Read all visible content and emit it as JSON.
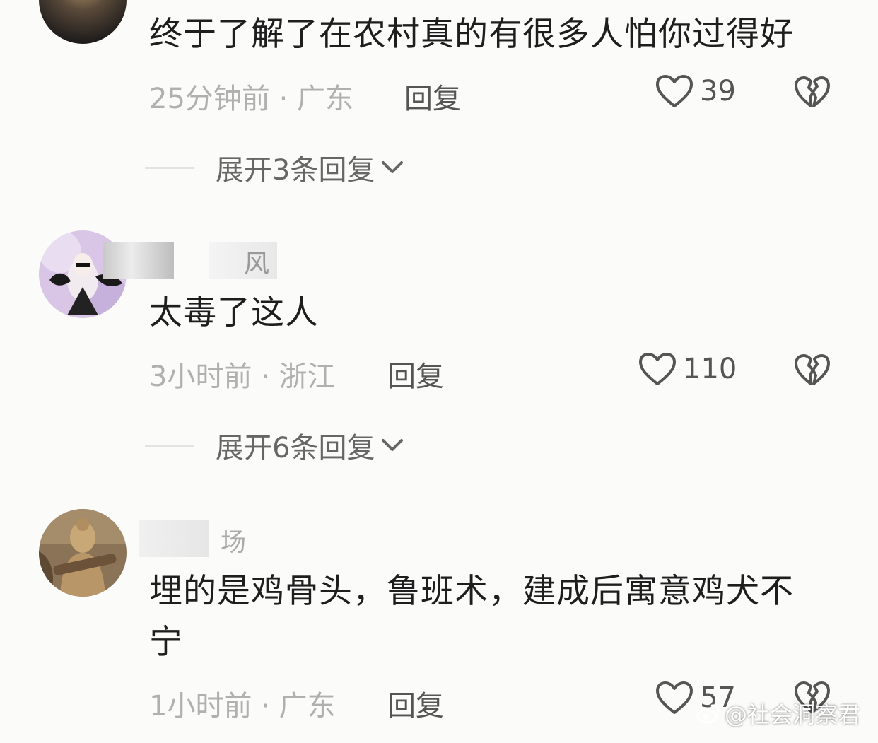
{
  "comments": [
    {
      "text": "终于了解了在农村真的有很多人怕你过得好",
      "time_loc": "25分钟前 · 广东",
      "reply_label": "回复",
      "likes": "39",
      "expand_label": "展开3条回复"
    },
    {
      "username_partial": "风",
      "text": "太毒了这人",
      "time_loc": "3小时前 · 浙江",
      "reply_label": "回复",
      "likes": "110",
      "expand_label": "展开6条回复"
    },
    {
      "username_partial": "场",
      "text_line1": "埋的是鸡骨头，鲁班术，建成后寓意鸡犬不",
      "text_line2": "宁",
      "time_loc": "1小时前 · 广东",
      "reply_label": "回复",
      "likes": "57"
    }
  ],
  "watermark": "@社会洞察君",
  "icons": {
    "like": "heart-outline-icon",
    "dislike": "broken-heart-icon",
    "expand": "chevron-down-icon",
    "watermark": "weibo-logo-icon"
  },
  "colors": {
    "background": "#fbfbfa",
    "text": "#1e1e1e",
    "meta": "#b0b0b0",
    "action": "#555555"
  }
}
